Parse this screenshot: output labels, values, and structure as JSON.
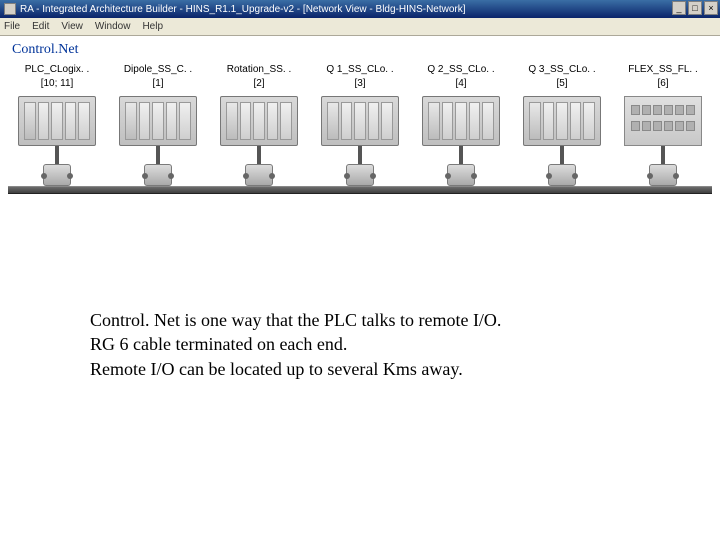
{
  "window": {
    "title": "RA - Integrated Architecture Builder - HINS_R1.1_Upgrade-v2 - [Network View - Bldg-HINS-Network]",
    "min": "_",
    "max": "□",
    "close": "×"
  },
  "menu": {
    "file": "File",
    "edit": "Edit",
    "view": "View",
    "window": "Window",
    "help": "Help"
  },
  "network": {
    "name": "Control.Net"
  },
  "nodes": [
    {
      "label": "PLC_CLogix. .",
      "addr": "[10; 11]",
      "kind": "rack"
    },
    {
      "label": "Dipole_SS_C. .",
      "addr": "[1]",
      "kind": "rack"
    },
    {
      "label": "Rotation_SS. .",
      "addr": "[2]",
      "kind": "rack"
    },
    {
      "label": "Q 1_SS_CLo. .",
      "addr": "[3]",
      "kind": "rack"
    },
    {
      "label": "Q 2_SS_CLo. .",
      "addr": "[4]",
      "kind": "rack"
    },
    {
      "label": "Q 3_SS_CLo. .",
      "addr": "[5]",
      "kind": "rack"
    },
    {
      "label": "FLEX_SS_FL. .",
      "addr": "[6]",
      "kind": "flex"
    }
  ],
  "caption": {
    "line1": "Control. Net is one way that the PLC talks to remote I/O.",
    "line2": "RG 6 cable terminated on each end.",
    "line3": "Remote I/O can be located up to several Kms away."
  }
}
